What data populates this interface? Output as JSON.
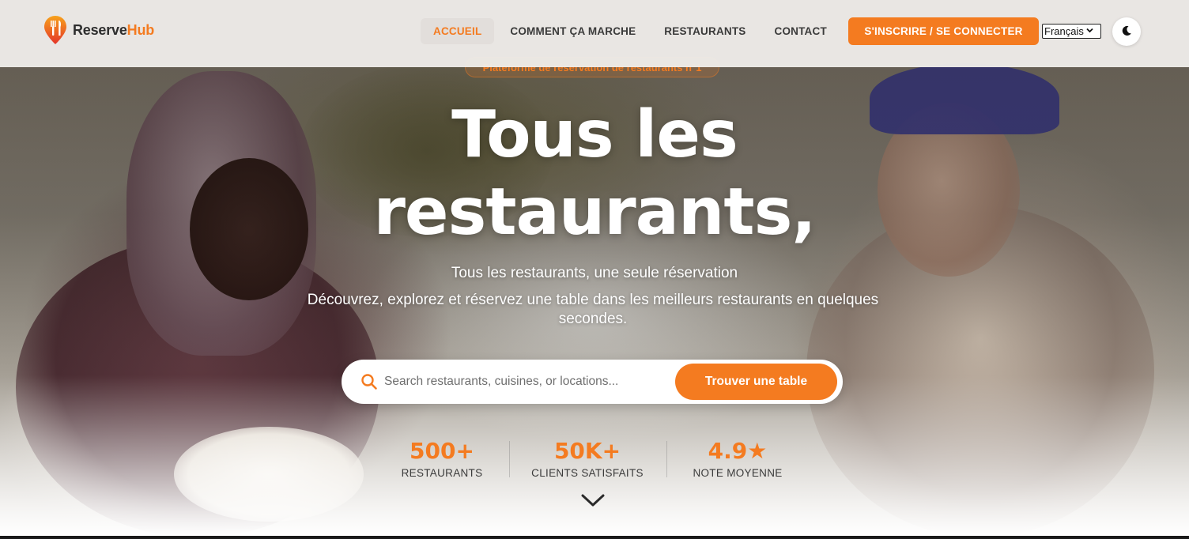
{
  "brand": {
    "name_part1": "Reserve",
    "name_part2": "Hub",
    "accent_color": "#f47b20"
  },
  "nav": {
    "links": [
      {
        "label": "ACCUEIL",
        "active": true
      },
      {
        "label": "COMMENT ÇA MARCHE",
        "active": false
      },
      {
        "label": "RESTAURANTS",
        "active": false
      },
      {
        "label": "CONTACT",
        "active": false
      }
    ],
    "cta_label": "S'INSCRIRE / SE CONNECTER",
    "language": "Français",
    "theme_icon": "moon-icon"
  },
  "hero": {
    "badge": "Plateforme de réservation de restaurants n°1",
    "title_line1": "Tous les",
    "title_line2": "restaurants,",
    "subtitle": "Tous les restaurants, une seule réservation",
    "description": "Découvrez, explorez et réservez une table dans les meilleurs restaurants en quelques secondes."
  },
  "search": {
    "placeholder": "Search restaurants, cuisines, or locations...",
    "button_label": "Trouver une table",
    "icon": "search-icon"
  },
  "stats": [
    {
      "value": "500+",
      "label": "RESTAURANTS"
    },
    {
      "value": "50K+",
      "label": "CLIENTS SATISFAITS"
    },
    {
      "value": "4.9★",
      "label": "NOTE MOYENNE"
    }
  ],
  "scroll_icon": "chevron-down-icon"
}
